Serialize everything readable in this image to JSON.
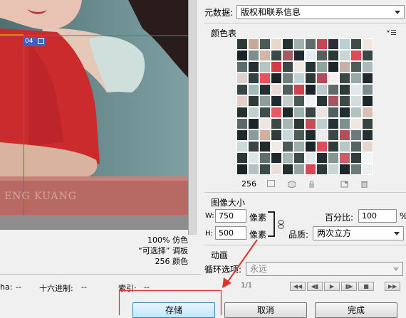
{
  "preview": {
    "slice_number": "04",
    "watermark": "ENG KUANG"
  },
  "image_info": {
    "line1_value": "100%",
    "line1_label": "仿色",
    "line2_value": "“可选择”",
    "line2_label": "调板",
    "line3_value": "256",
    "line3_label": "颜色"
  },
  "status_bar": {
    "alpha_label": "ha:",
    "alpha_value": "--",
    "hex_label": "十六进制:",
    "hex_value": "--",
    "index_label": "索引:",
    "index_value": "--"
  },
  "metadata": {
    "label": "元数据:",
    "value": "版权和联系信息"
  },
  "color_table": {
    "title": "颜色表",
    "menu_icon": "panel-menu-icon",
    "count": "256",
    "colors": [
      "#2b3a38",
      "#c7a99a",
      "#4a5a57",
      "#e8d8cc",
      "#223430",
      "#9fb0ad",
      "#5f6c6a",
      "#c34652",
      "#2e2e3b",
      "#b8cfd4",
      "#3e4c4a",
      "#f0e6e0",
      "#172326",
      "#7d8f8d",
      "#d6b3a8",
      "#374a47",
      "#a35a62",
      "#1e2a2e",
      "#e3eef0",
      "#56605f",
      "#2a3936",
      "#c9d6d3",
      "#e04a55",
      "#394847",
      "#5a6f6c",
      "#252f33",
      "#b7c5c2",
      "#d33a46",
      "#3b4745",
      "#f2e9e4",
      "#263336",
      "#8fa3a0",
      "#1c2528",
      "#c7b0a6",
      "#4d5d5a",
      "#a9bcbb",
      "#dcd1cb",
      "#334240",
      "#e9525d",
      "#1b2326",
      "#6e7f7c",
      "#c2d3d6",
      "#2c3a37",
      "#b34c56",
      "#f5f0ed",
      "#3a4846",
      "#98aaa8",
      "#202a2d",
      "#374543",
      "#a7b9b6",
      "#24302f",
      "#e7dbd4",
      "#4f5f5c",
      "#cf4450",
      "#1a2427",
      "#b9cacb",
      "#5d6b69",
      "#2d3b38",
      "#dfe9ea",
      "#7c8e8b",
      "#e3cfc6",
      "#2f3b3a",
      "#8da09d",
      "#1f2b2e",
      "#c4cfcd",
      "#4a5856",
      "#f0f4f4",
      "#293533",
      "#aa5560",
      "#3c4a48",
      "#d2dede",
      "#1d272a",
      "#26312f",
      "#c0d0cd",
      "#3f4d4b",
      "#e55865",
      "#1e282b",
      "#9eb1ae",
      "#364442",
      "#ece3de",
      "#52615f",
      "#223033",
      "#b2c4c2",
      "#d9c0b6",
      "#5b6a68",
      "#1b2528",
      "#ebe6e3",
      "#3b4947",
      "#a4b7b4",
      "#2a3633",
      "#c94a55",
      "#bfcfd1",
      "#263235",
      "#7e908e",
      "#efe7e2",
      "#344240",
      "#1e2a2c",
      "#8a9d9a",
      "#d4ae9f",
      "#2f3d3a",
      "#c8d9db",
      "#4c5a58",
      "#202b2e",
      "#e8edee",
      "#3a4745",
      "#b05059",
      "#6a7b79",
      "#252f31",
      "#cbdadb",
      "#374442",
      "#202a2c",
      "#f1ebe7",
      "#4b5957",
      "#9bafad",
      "#1c2629",
      "#dc4f5a",
      "#2f3c39",
      "#b6c7c6",
      "#556462",
      "#e2d6cf",
      "#2c3836",
      "#dce6e6",
      "#5f6f6c",
      "#1f292b",
      "#a6b8b6",
      "#3d4a48",
      "#e1e9eb",
      "#232e30",
      "#84968f",
      "#ce5c66",
      "#303d3b",
      "#f3f6f7",
      "#1a2325",
      "#b4c3c1",
      "#3e4c49",
      "#e9dfd9",
      "#24302e",
      "#92a6a4",
      "#d84955",
      "#2e3a38",
      "#c6d5d4",
      "#1d2628",
      "#6b7b78",
      "#ebeff0",
      "#42504d",
      "#27312f",
      "#a1b4b2",
      "#1c2628",
      "#cfdbdb",
      "#384644",
      "#e6ebeb",
      "#2a3533",
      "#798b88",
      "#1e272a",
      "#b9c8c7",
      "#c55865",
      "#212b2d",
      "#8c9f9c",
      "#2e3a39",
      "#eaf0f1",
      "#445250",
      "#1b2427",
      "#bdcbcb",
      "#344240",
      "#f0e4de",
      "#28332f",
      "#96a9a6",
      "#1f292c",
      "#3a4846",
      "#1e282a",
      "#d5e0e0",
      "#2d3836",
      "#a7b9b7",
      "#222c2e",
      "#5b6967",
      "#e7eeef",
      "#293432",
      "#b04955",
      "#1c2527",
      "#8fa29f",
      "#1d2729",
      "#4a5856",
      "#26302f",
      "#c1cfcf",
      "#1b2426",
      "#343f3e",
      "#e1e8e9",
      "#202a2c",
      "#7f918e",
      "#2b3634",
      "#c7d4d4",
      "#1a2224"
    ],
    "icons": [
      "map-to-transparent-icon",
      "web-snap-icon",
      "lock-color-icon",
      "new-color-icon",
      "delete-color-icon"
    ]
  },
  "image_size": {
    "title": "图像大小",
    "width_label": "W:",
    "width_value": "750",
    "width_unit": "像素",
    "height_label": "H:",
    "height_value": "500",
    "height_unit": "像素",
    "percent_label": "百分比:",
    "percent_value": "100",
    "percent_unit": "%",
    "quality_label": "品质:",
    "quality_value": "两次立方"
  },
  "animation": {
    "title": "动画",
    "loop_label": "循环选项:",
    "loop_value": "永远",
    "frame_counter": "1/1"
  },
  "buttons": {
    "save": "存储",
    "cancel": "取消",
    "done": "完成"
  },
  "annotation": {
    "color": "#e0322f"
  }
}
